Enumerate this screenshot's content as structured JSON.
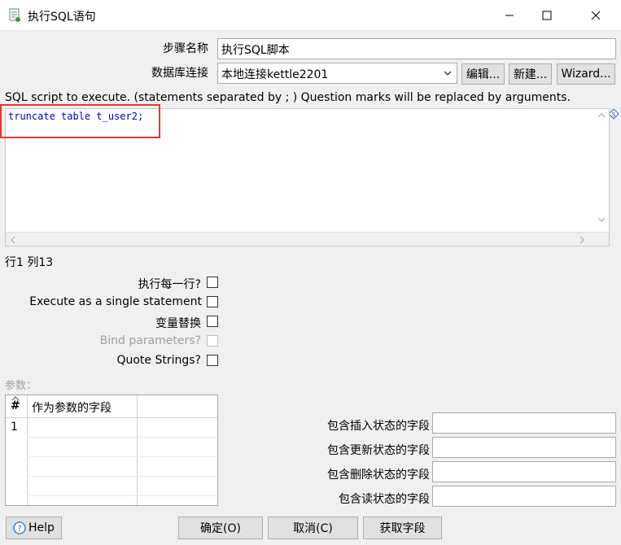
{
  "window": {
    "title": "执行SQL语句",
    "minimize_icon": "minimize-icon",
    "maximize_icon": "maximize-icon",
    "close_icon": "close-icon"
  },
  "form": {
    "step_name_label": "步骤名称",
    "step_name_value": "执行SQL脚本",
    "connection_label": "数据库连接",
    "connection_value": "本地连接kettle2201",
    "edit_button": "编辑...",
    "new_button": "新建...",
    "wizard_button": "Wizard..."
  },
  "sql": {
    "description": "SQL script to execute. (statements separated by ; ) Question marks will be replaced by arguments.",
    "script": "truncate table t_user2;",
    "position": "行1 列13"
  },
  "options": {
    "execute_each_row": "执行每一行?",
    "single_statement": "Execute as a single statement",
    "variable_substitution": "变量替换",
    "bind_parameters": "Bind parameters?",
    "quote_strings": "Quote Strings?"
  },
  "params": {
    "label": "参数：",
    "columns": [
      "#",
      "作为参数的字段"
    ],
    "rows": [
      [
        "1",
        ""
      ]
    ]
  },
  "status_fields": {
    "insert_label": "包含插入状态的字段",
    "update_label": "包含更新状态的字段",
    "delete_label": "包含删除状态的字段",
    "read_label": "包含读状态的字段"
  },
  "footer": {
    "help": "Help",
    "ok": "确定(O)",
    "cancel": "取消(C)",
    "get_fields": "获取字段"
  }
}
